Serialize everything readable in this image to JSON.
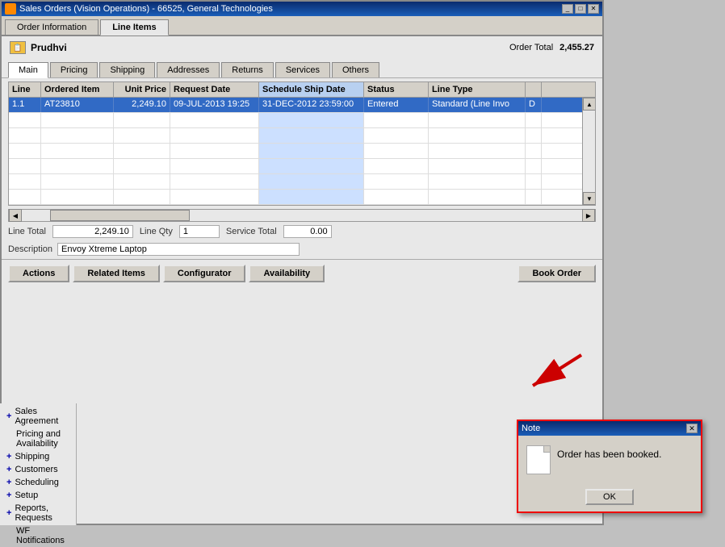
{
  "window": {
    "title": "Sales Orders (Vision Operations) - 66525, General Technologies",
    "icon": "sales-orders-icon"
  },
  "top_tabs": [
    {
      "label": "Order Information",
      "active": false
    },
    {
      "label": "Line Items",
      "active": true
    }
  ],
  "order": {
    "name": "Prudhvi",
    "total_label": "Order Total",
    "total_value": "2,455.27"
  },
  "sub_tabs": [
    {
      "label": "Main",
      "active": true
    },
    {
      "label": "Pricing",
      "active": false
    },
    {
      "label": "Shipping",
      "active": false
    },
    {
      "label": "Addresses",
      "active": false
    },
    {
      "label": "Returns",
      "active": false
    },
    {
      "label": "Services",
      "active": false
    },
    {
      "label": "Others",
      "active": false
    }
  ],
  "table": {
    "columns": [
      {
        "label": "Line",
        "class": "col-line"
      },
      {
        "label": "Ordered Item",
        "class": "col-item"
      },
      {
        "label": "Unit Price",
        "class": "col-price"
      },
      {
        "label": "Request Date",
        "class": "col-reqdate"
      },
      {
        "label": "Schedule Ship Date",
        "class": "col-shipdate"
      },
      {
        "label": "Status",
        "class": "col-status"
      },
      {
        "label": "Line Type",
        "class": "col-linetype"
      },
      {
        "label": "",
        "class": "col-extra"
      }
    ],
    "rows": [
      {
        "selected": true,
        "cells": [
          "1.1",
          "AT23810",
          "2,249.10",
          "09-JUL-2013 19:25",
          "31-DEC-2012 23:59:00",
          "Entered",
          "Standard (Line Invo",
          "D"
        ]
      },
      {
        "selected": false,
        "cells": [
          "",
          "",
          "",
          "",
          "",
          "",
          "",
          ""
        ]
      },
      {
        "selected": false,
        "cells": [
          "",
          "",
          "",
          "",
          "",
          "",
          "",
          ""
        ]
      },
      {
        "selected": false,
        "cells": [
          "",
          "",
          "",
          "",
          "",
          "",
          "",
          ""
        ]
      },
      {
        "selected": false,
        "cells": [
          "",
          "",
          "",
          "",
          "",
          "",
          "",
          ""
        ]
      },
      {
        "selected": false,
        "cells": [
          "",
          "",
          "",
          "",
          "",
          "",
          "",
          ""
        ]
      },
      {
        "selected": false,
        "cells": [
          "",
          "",
          "",
          "",
          "",
          "",
          "",
          ""
        ]
      }
    ]
  },
  "footer": {
    "line_total_label": "Line Total",
    "line_total_value": "2,249.10",
    "line_qty_label": "Line Qty",
    "line_qty_value": "1",
    "service_total_label": "Service Total",
    "service_total_value": "0.00",
    "description_label": "Description",
    "description_value": "Envoy Xtreme Laptop"
  },
  "action_buttons": [
    {
      "label": "Actions",
      "name": "actions-button"
    },
    {
      "label": "Related Items",
      "name": "related-items-button"
    },
    {
      "label": "Configurator",
      "name": "configurator-button"
    },
    {
      "label": "Availability",
      "name": "availability-button"
    },
    {
      "label": "Book Order",
      "name": "book-order-button"
    }
  ],
  "nav_items": [
    {
      "label": "Sales Agreement",
      "plus": true
    },
    {
      "label": "Pricing and Availability",
      "plus": false
    },
    {
      "label": "Shipping",
      "plus": true
    },
    {
      "label": "Customers",
      "plus": true
    },
    {
      "label": "Scheduling",
      "plus": true
    },
    {
      "label": "Setup",
      "plus": true
    },
    {
      "label": "Reports, Requests",
      "plus": true
    },
    {
      "label": "WF Notifications",
      "plus": false
    }
  ],
  "note_dialog": {
    "title": "Note",
    "message": "Order has been booked.",
    "ok_label": "OK"
  },
  "colors": {
    "title_bar_start": "#0a2b6e",
    "title_bar_end": "#1a5eb8",
    "selected_row": "#316ac5",
    "ship_date_bg": "#cce0ff",
    "note_border": "#e00000"
  }
}
